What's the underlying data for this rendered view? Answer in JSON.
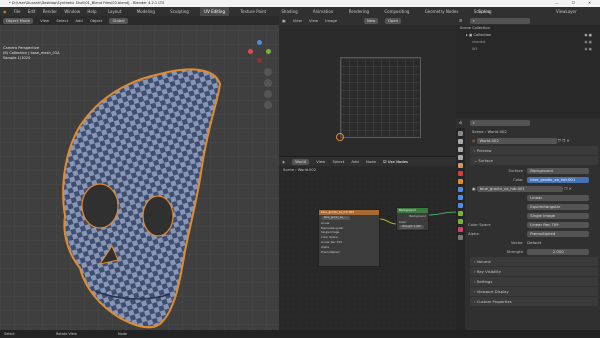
{
  "window": {
    "title": "* D:\\User\\Ducanh\\Desktop\\Synthetic Skull\\01_Blend Files\\03.blend] - Blender 4.2.1 LTS",
    "controls": "— ☐ ✕"
  },
  "menu": {
    "items": [
      "File",
      "Edit",
      "Render",
      "Window",
      "Help"
    ],
    "workspaces": [
      "Layout",
      "Modeling",
      "Sculpting",
      "UV Editing",
      "Texture Paint",
      "Shading",
      "Animation",
      "Rendering",
      "Compositing",
      "Geometry Nodes",
      "Scripting"
    ],
    "active_workspace": "UV Editing",
    "scene": "Scene",
    "view_layer": "ViewLayer"
  },
  "viewport3d": {
    "header": [
      "Object Mode",
      "View",
      "Select",
      "Add",
      "Object",
      "Global"
    ],
    "overlay": [
      "Camera Perspective",
      "(8) Collection | base_mesh_01A",
      "Sample 1/1024"
    ]
  },
  "image_editor": {
    "header": [
      "View",
      "View",
      "Image"
    ],
    "new_label": "New",
    "open_label": "Open"
  },
  "node_editor": {
    "header": [
      "World",
      "View",
      "Select",
      "Add",
      "Node"
    ],
    "use_nodes": "Use Nodes",
    "breadcrumb": [
      "Scene",
      "World.002"
    ],
    "image_node": {
      "title": "blue_grodlu_xa_hdr.001",
      "file": "blue_grodu_xa_...",
      "rows": [
        "Linear",
        "Equirectangular",
        "Single Image",
        "Color Space",
        "Linear Rec.709",
        "Alpha",
        "Premultiplied"
      ]
    },
    "bg_node": {
      "title": "Background",
      "output": "Background",
      "rows": [
        "Color",
        "Strength   1.000"
      ]
    }
  },
  "outliner": {
    "header": "Scene Collection",
    "items": [
      "Collection",
      "shaded",
      "W1"
    ]
  },
  "properties": {
    "breadcrumb": [
      "Scene",
      "World.002"
    ],
    "world_name": "World.002",
    "sections": [
      "Preview",
      "Surface"
    ],
    "surface_label": "Surface",
    "surface_value": "Background",
    "color_label": "Color",
    "color_value": "blue_grodlu_xa_hdr.001",
    "image_name": "blue_grodlu_xa_hdr.001",
    "interp": "Linear",
    "projection": "Equirectangular",
    "source": "Single Image",
    "color_space_label": "Color Space",
    "color_space_value": "Linear Rec.709",
    "alpha_label": "Alpha",
    "alpha_value": "Premultiplied",
    "vector_label": "Vector",
    "vector_value": "Default",
    "strength_label": "Strength",
    "strength_value": "2.000",
    "collapsed": [
      "Volume",
      "Ray Visibility",
      "Settings",
      "Viewport Display",
      "Custom Properties"
    ]
  },
  "statusbar": {
    "left": "Select",
    "mid": "Rotate View",
    "right": "Node"
  },
  "colors": {
    "accent": "#e38b2c",
    "active_tab": "#4772b3",
    "bg_node_header": "#3b7b3f",
    "image_node_header": "#a86a33"
  }
}
